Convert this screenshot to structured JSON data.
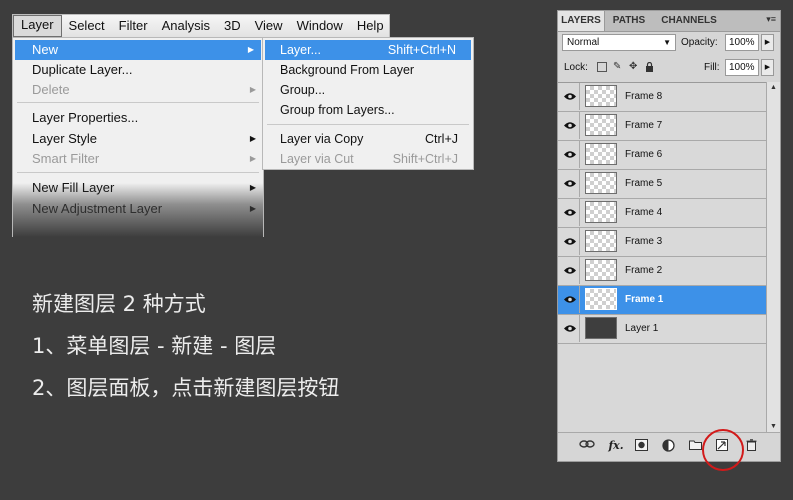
{
  "menubar": {
    "items": [
      "Layer",
      "Select",
      "Filter",
      "Analysis",
      "3D",
      "View",
      "Window",
      "Help"
    ]
  },
  "layer_menu": {
    "items": [
      {
        "label": "New",
        "state": "highlighted",
        "submenu": true
      },
      {
        "label": "Duplicate Layer...",
        "state": "normal"
      },
      {
        "label": "Delete",
        "state": "disabled",
        "submenu": true
      },
      {
        "label": "Layer Properties...",
        "state": "normal"
      },
      {
        "label": "Layer Style",
        "state": "normal",
        "submenu": true
      },
      {
        "label": "Smart Filter",
        "state": "disabled",
        "submenu": true
      },
      {
        "label": "New Fill Layer",
        "state": "normal",
        "submenu": true
      },
      {
        "label": "New Adjustment Layer",
        "state": "normal",
        "submenu": true
      }
    ]
  },
  "new_submenu": {
    "items": [
      {
        "label": "Layer...",
        "shortcut": "Shift+Ctrl+N",
        "state": "highlighted"
      },
      {
        "label": "Background From Layer",
        "shortcut": "",
        "state": "normal"
      },
      {
        "label": "Group...",
        "shortcut": "",
        "state": "normal"
      },
      {
        "label": "Group from Layers...",
        "shortcut": "",
        "state": "normal"
      },
      {
        "label": "Layer via Copy",
        "shortcut": "Ctrl+J",
        "state": "normal"
      },
      {
        "label": "Layer via Cut",
        "shortcut": "Shift+Ctrl+J",
        "state": "disabled"
      }
    ]
  },
  "caption": {
    "line1": "新建图层 2 种方式",
    "line2": "1、菜单图层 - 新建 - 图层",
    "line3": "2、图层面板，点击新建图层按钮"
  },
  "layers_panel": {
    "tabs": [
      "LAYERS",
      "PATHS",
      "CHANNELS"
    ],
    "menu_glyph": "▾≡",
    "blend_mode": "Normal",
    "opacity_label": "Opacity:",
    "opacity_value": "100%",
    "lock_label": "Lock:",
    "fill_label": "Fill:",
    "fill_value": "100%",
    "layers": [
      {
        "name": "Frame 8",
        "visible": true,
        "selected": false,
        "thumb": "transparent"
      },
      {
        "name": "Frame 7",
        "visible": true,
        "selected": false,
        "thumb": "transparent"
      },
      {
        "name": "Frame 6",
        "visible": true,
        "selected": false,
        "thumb": "transparent"
      },
      {
        "name": "Frame 5",
        "visible": true,
        "selected": false,
        "thumb": "transparent"
      },
      {
        "name": "Frame 4",
        "visible": true,
        "selected": false,
        "thumb": "transparent"
      },
      {
        "name": "Frame 3",
        "visible": true,
        "selected": false,
        "thumb": "transparent"
      },
      {
        "name": "Frame 2",
        "visible": true,
        "selected": false,
        "thumb": "transparent"
      },
      {
        "name": "Frame 1",
        "visible": true,
        "selected": true,
        "thumb": "transparent"
      },
      {
        "name": "Layer 1",
        "visible": true,
        "selected": false,
        "thumb": "dark"
      }
    ],
    "bottom_icons": [
      "link-icon",
      "fx-icon",
      "mask-icon",
      "adjustment-icon",
      "group-folder-icon",
      "new-layer-icon",
      "trash-icon"
    ],
    "fx_text": "fx.",
    "highlight_color": "#d21a1a",
    "selection_color": "#3d91e8"
  }
}
